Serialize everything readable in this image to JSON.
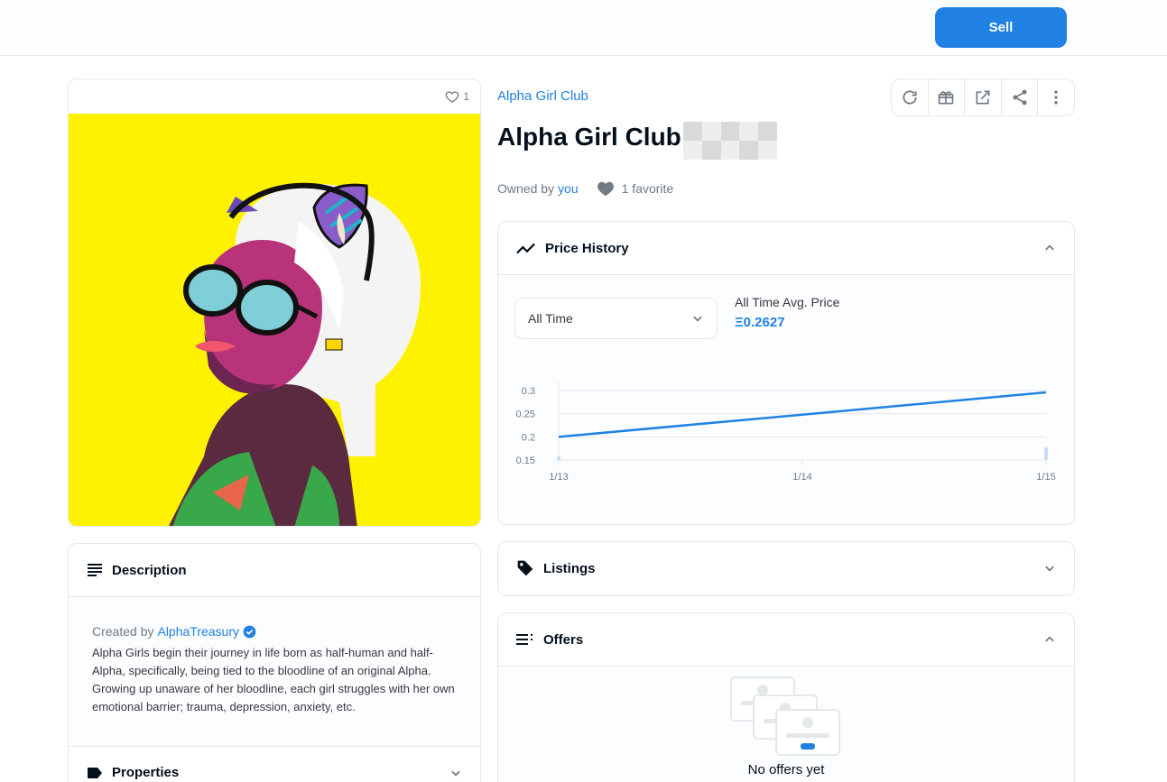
{
  "header": {
    "sell_label": "Sell"
  },
  "image_card": {
    "favorite_count": "1",
    "background_color": "#fff200"
  },
  "item": {
    "collection": "Alpha Girl Club",
    "title": "Alpha Girl Club",
    "owned_by_prefix": "Owned by",
    "owner": "you",
    "favorites": "1 favorite"
  },
  "actions": [
    "refresh-icon",
    "gift-icon",
    "external-link-icon",
    "share-icon",
    "more-icon"
  ],
  "price_history": {
    "title": "Price History",
    "range_selected": "All Time",
    "avg_label": "All Time Avg. Price",
    "avg_value": "Ξ0.2627",
    "chart_data": {
      "type": "line",
      "title": "",
      "x": [
        "1/13",
        "1/14",
        "1/15"
      ],
      "y_ticks": [
        "0.3",
        "0.25",
        "0.2",
        "0.15"
      ],
      "ylim": [
        0.15,
        0.3
      ],
      "series": [
        {
          "points": [
            [
              0,
              0.2
            ],
            [
              1,
              0.248
            ],
            [
              2,
              0.296
            ]
          ]
        }
      ],
      "volume": [
        {
          "x": 0,
          "value": 0.1
        },
        {
          "x": 2,
          "value": 0.6
        }
      ],
      "grid": true,
      "color": "#2081e2"
    }
  },
  "description": {
    "title": "Description",
    "created_by_prefix": "Created by",
    "creator": "AlphaTreasury",
    "text": "Alpha Girls begin their journey in life born as half-human and half-Alpha, specifically, being tied to the bloodline of an original Alpha. Growing up unaware of her bloodline, each girl struggles with her own emotional barrier; trauma, depression, anxiety, etc."
  },
  "properties": {
    "title": "Properties"
  },
  "listings": {
    "title": "Listings"
  },
  "offers": {
    "title": "Offers",
    "empty_text": "No offers yet"
  }
}
